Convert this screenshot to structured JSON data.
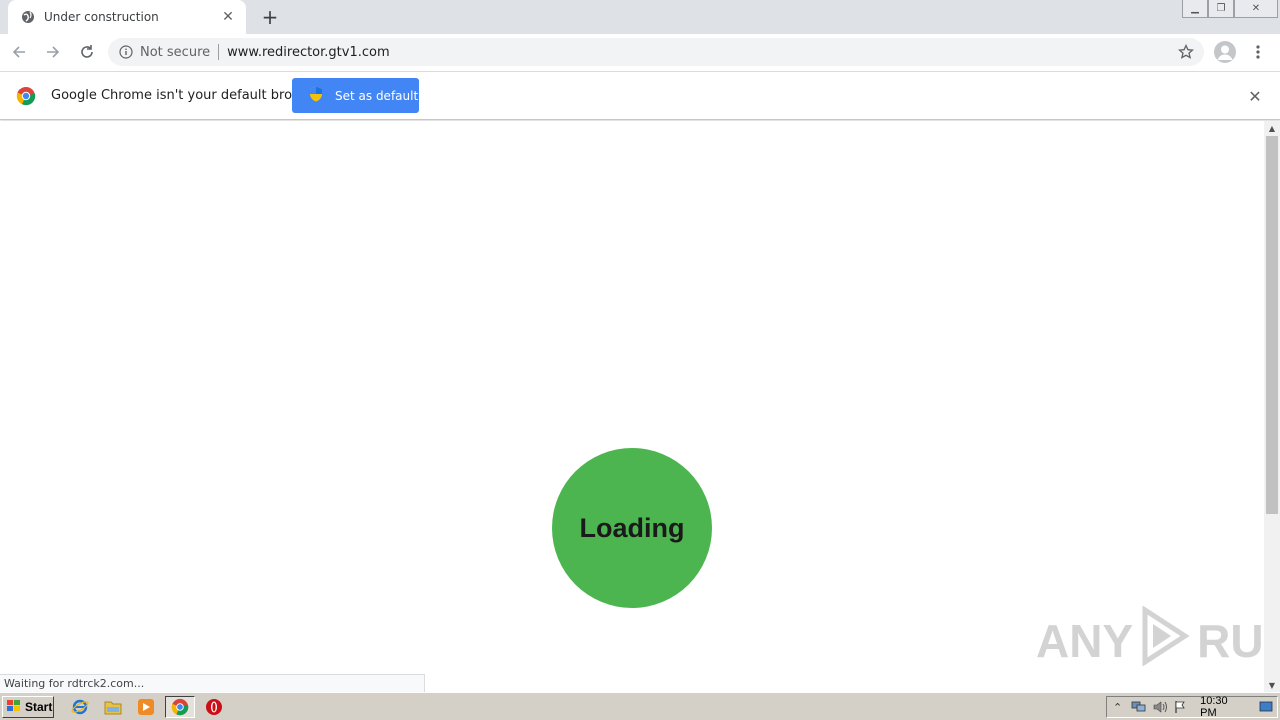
{
  "browser": {
    "tab": {
      "title": "Under construction"
    },
    "omnibox": {
      "security_text": "Not secure",
      "url": "www.redirector.gtv1.com"
    }
  },
  "infobar": {
    "message": "Google Chrome isn't your default browser",
    "button_label": "Set as default"
  },
  "page": {
    "loader_text": "Loading",
    "loader_color": "#4cb54f"
  },
  "status": {
    "text": "Waiting for rdtrck2.com..."
  },
  "watermark": {
    "left": "ANY",
    "right": "RUN"
  },
  "taskbar": {
    "start_label": "Start",
    "clock": "10:30 PM",
    "pinned": [
      "ie-icon",
      "explorer-icon",
      "media-player-icon",
      "chrome-icon",
      "opera-icon"
    ]
  },
  "colors": {
    "accent": "#4285f4",
    "tabstrip": "#dee1e6"
  }
}
